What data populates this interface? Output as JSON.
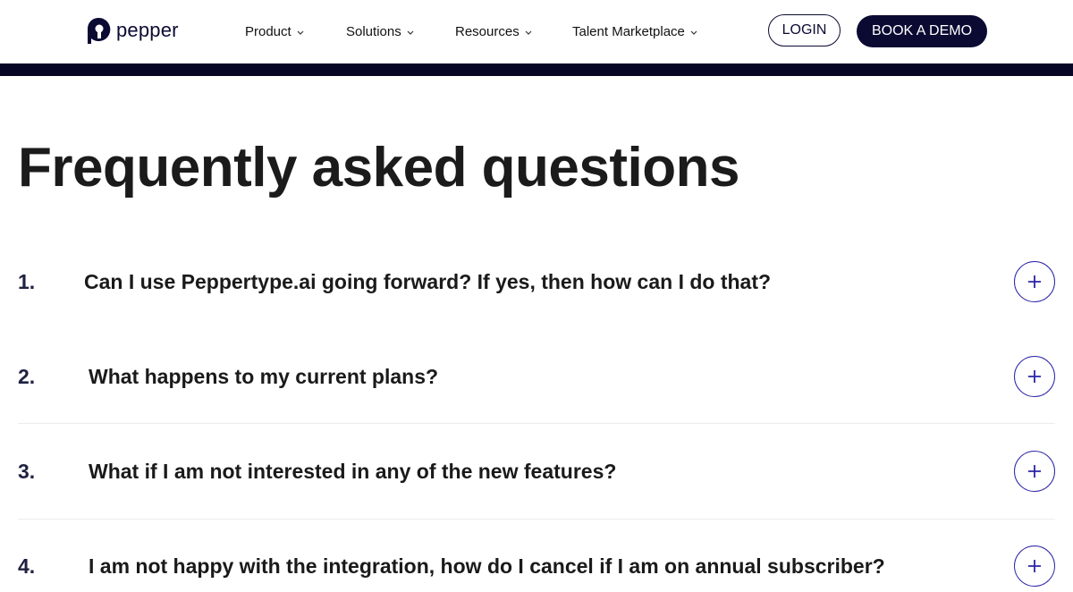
{
  "brand": {
    "name": "pepper"
  },
  "nav": {
    "items": [
      {
        "label": "Product"
      },
      {
        "label": "Solutions"
      },
      {
        "label": "Resources"
      },
      {
        "label": "Talent Marketplace"
      }
    ],
    "login_label": "LOGIN",
    "demo_label": "BOOK A DEMO"
  },
  "faq": {
    "title": "Frequently asked questions",
    "items": [
      {
        "number": "1.",
        "question": "Can I use Peppertype.ai going forward? If yes, then how can I do that?"
      },
      {
        "number": "2.",
        "question": "What happens to my current plans?"
      },
      {
        "number": "3.",
        "question": "What if I am not interested in any of the new features?"
      },
      {
        "number": "4.",
        "question": "I am not happy with the integration, how do I cancel if I am on annual subscriber?"
      }
    ]
  },
  "colors": {
    "brand_navy": "#0b0a33",
    "header_bar": "#070625",
    "accent_yellow": "#ffe14d",
    "toggle_border": "#2a24a6"
  },
  "icons": {
    "logo": "pepper-logo-icon",
    "nav_chevron": "chevron-down-icon",
    "faq_toggle": "plus-icon"
  }
}
